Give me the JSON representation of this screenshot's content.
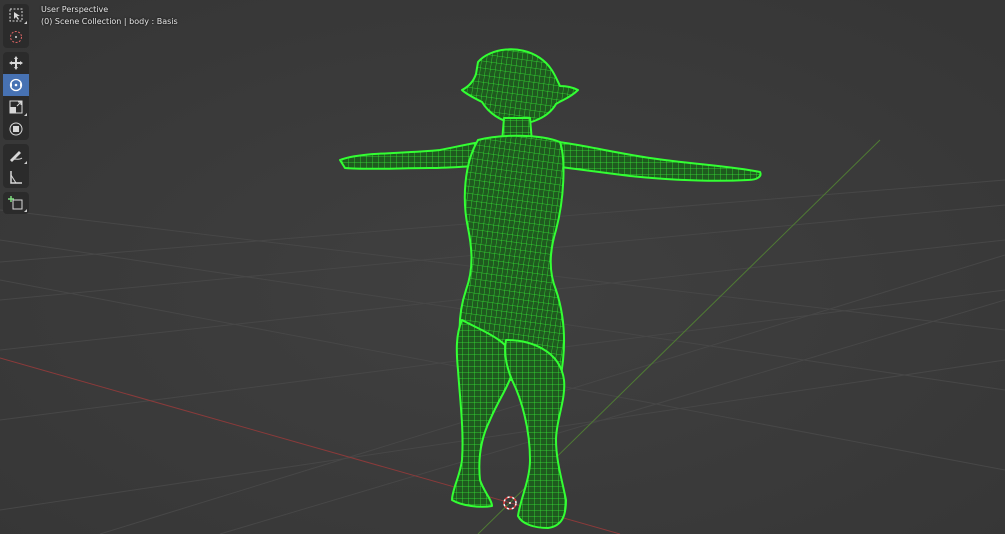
{
  "viewport": {
    "view_name": "User Perspective",
    "collection_info": "(0) Scene Collection | body : Basis"
  },
  "toolbar": {
    "tools": [
      {
        "name": "select-box",
        "icon": "select-box-icon",
        "active": false
      },
      {
        "name": "cursor",
        "icon": "cursor-icon",
        "active": false
      },
      {
        "name": "move",
        "icon": "move-icon",
        "active": false
      },
      {
        "name": "rotate",
        "icon": "rotate-icon",
        "active": true
      },
      {
        "name": "scale",
        "icon": "scale-icon",
        "active": false
      },
      {
        "name": "transform",
        "icon": "transform-icon",
        "active": false
      },
      {
        "name": "annotate",
        "icon": "annotate-icon",
        "active": false
      },
      {
        "name": "measure",
        "icon": "measure-icon",
        "active": false
      },
      {
        "name": "add-cube",
        "icon": "add-cube-icon",
        "active": false
      }
    ]
  },
  "colors": {
    "background": "#3d3d3d",
    "grid": "#474747",
    "x_axis": "#8a3a3a",
    "y_axis": "#4f7a34",
    "wireframe": "#33ff33",
    "accent": "#4772b3"
  }
}
